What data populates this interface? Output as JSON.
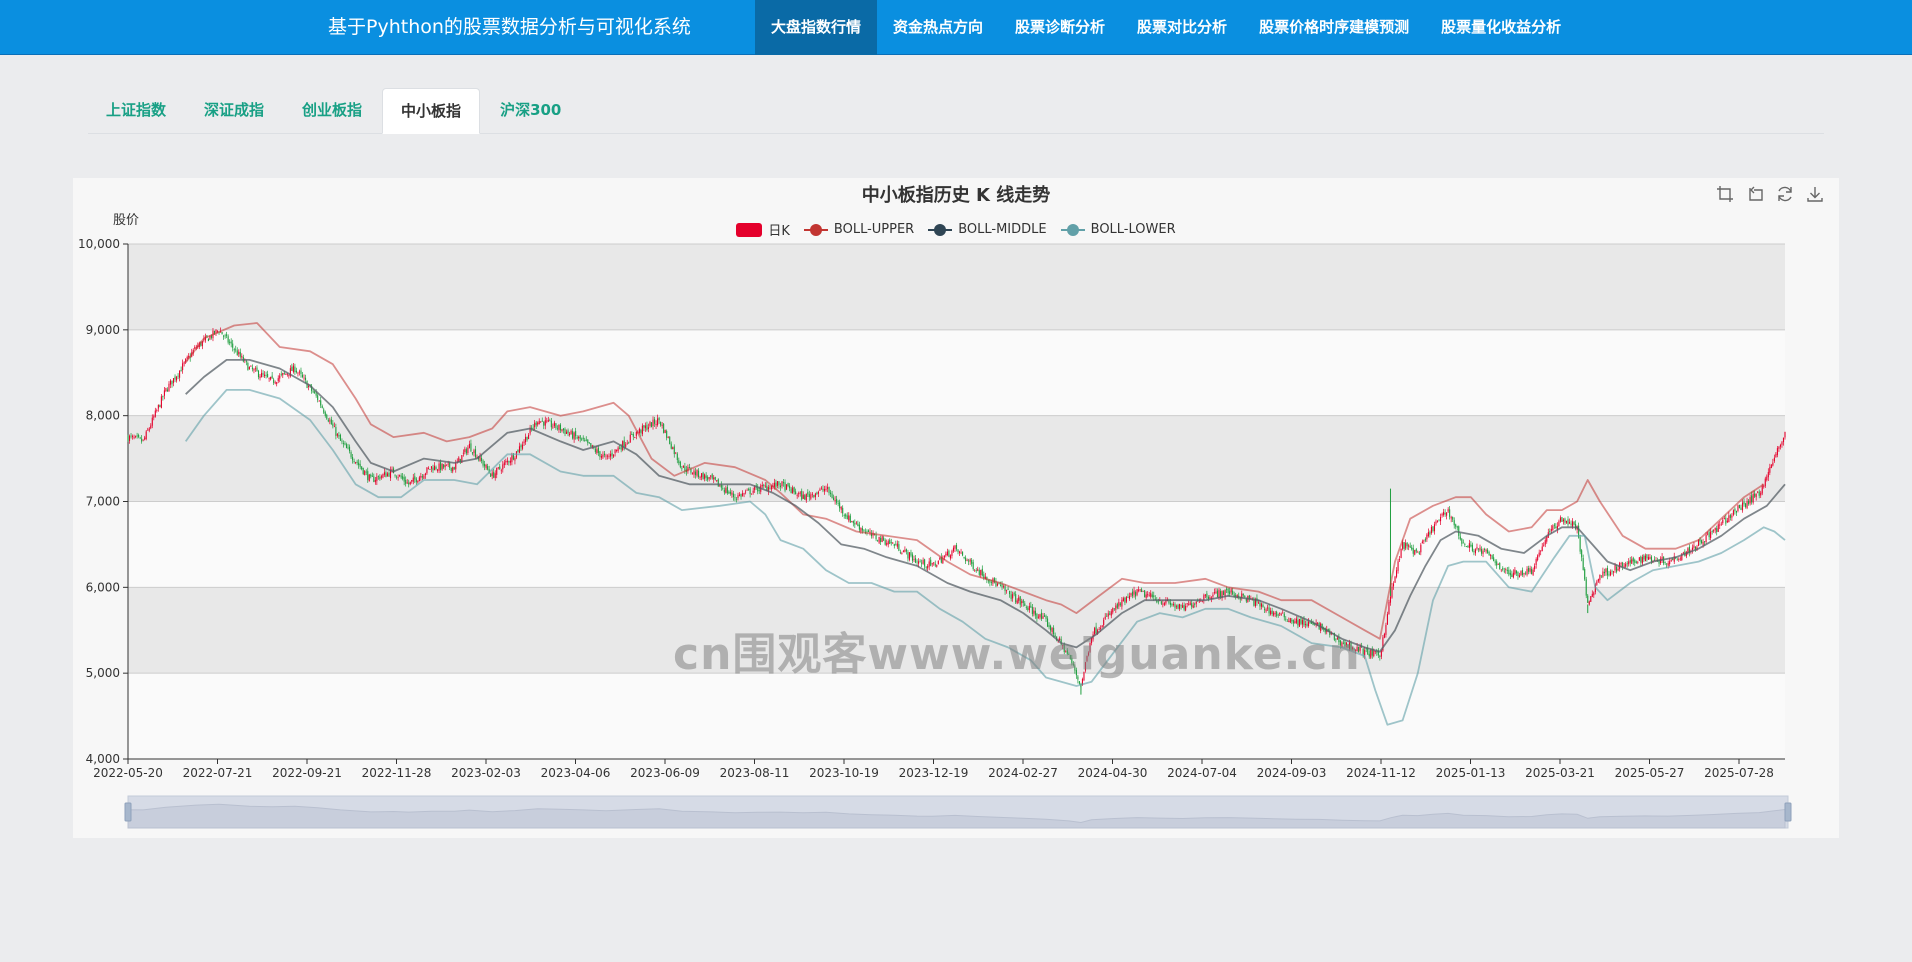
{
  "app": {
    "title": "基于Pyhthon的股票数据分析与可视化系统"
  },
  "nav": [
    {
      "label": "大盘指数行情",
      "active": true
    },
    {
      "label": "资金热点方向",
      "active": false
    },
    {
      "label": "股票诊断分析",
      "active": false
    },
    {
      "label": "股票对比分析",
      "active": false
    },
    {
      "label": "股票价格时序建模预测",
      "active": false
    },
    {
      "label": "股票量化收益分析",
      "active": false
    }
  ],
  "tabs": [
    {
      "label": "上证指数",
      "active": false
    },
    {
      "label": "深证成指",
      "active": false
    },
    {
      "label": "创业板指",
      "active": false
    },
    {
      "label": "中小板指",
      "active": true
    },
    {
      "label": "沪深300",
      "active": false
    }
  ],
  "watermark": "cn围观客www.weiguanke.cn",
  "colors": {
    "up": "#e4002b",
    "down": "#1e9e3e",
    "upper": "#c23531",
    "middle": "#2f4554",
    "lower": "#61a0a8"
  },
  "chart_data": {
    "type": "candlestick",
    "title": "中小板指历史 K 线走势",
    "ylabel": "股价",
    "ylim": [
      4000,
      10000
    ],
    "yticks": [
      "4,000",
      "5,000",
      "6,000",
      "7,000",
      "8,000",
      "9,000",
      "10,000"
    ],
    "xticks": [
      "2022-05-20",
      "2022-07-21",
      "2022-09-21",
      "2022-11-28",
      "2023-02-03",
      "2023-04-06",
      "2023-06-09",
      "2023-08-11",
      "2023-10-19",
      "2023-12-19",
      "2024-02-27",
      "2024-04-30",
      "2024-07-04",
      "2024-09-03",
      "2024-11-12",
      "2025-01-13",
      "2025-03-21",
      "2025-05-27",
      "2025-07-28"
    ],
    "legend": [
      "日K",
      "BOLL-UPPER",
      "BOLL-MIDDLE",
      "BOLL-LOWER"
    ],
    "grid": true,
    "series": [
      {
        "name": "日K",
        "close": [
          [
            0,
            7750
          ],
          [
            10,
            7700
          ],
          [
            25,
            8300
          ],
          [
            45,
            8800
          ],
          [
            60,
            9000
          ],
          [
            80,
            8550
          ],
          [
            95,
            8400
          ],
          [
            110,
            8550
          ],
          [
            125,
            8200
          ],
          [
            140,
            7700
          ],
          [
            160,
            7250
          ],
          [
            175,
            7350
          ],
          [
            185,
            7200
          ],
          [
            200,
            7400
          ],
          [
            215,
            7400
          ],
          [
            225,
            7650
          ],
          [
            240,
            7300
          ],
          [
            255,
            7550
          ],
          [
            270,
            7950
          ],
          [
            285,
            7850
          ],
          [
            300,
            7700
          ],
          [
            315,
            7500
          ],
          [
            335,
            7800
          ],
          [
            350,
            7950
          ],
          [
            365,
            7400
          ],
          [
            385,
            7250
          ],
          [
            400,
            7050
          ],
          [
            415,
            7150
          ],
          [
            430,
            7200
          ],
          [
            445,
            7050
          ],
          [
            460,
            7150
          ],
          [
            475,
            6800
          ],
          [
            490,
            6600
          ],
          [
            505,
            6500
          ],
          [
            520,
            6300
          ],
          [
            530,
            6250
          ],
          [
            545,
            6450
          ],
          [
            560,
            6200
          ],
          [
            575,
            6000
          ],
          [
            590,
            5800
          ],
          [
            605,
            5600
          ],
          [
            620,
            5200
          ],
          [
            628,
            4850
          ],
          [
            635,
            5450
          ],
          [
            650,
            5750
          ],
          [
            665,
            5950
          ],
          [
            680,
            5850
          ],
          [
            695,
            5750
          ],
          [
            710,
            5900
          ],
          [
            725,
            5950
          ],
          [
            740,
            5850
          ],
          [
            755,
            5700
          ],
          [
            770,
            5600
          ],
          [
            785,
            5550
          ],
          [
            800,
            5350
          ],
          [
            815,
            5250
          ],
          [
            825,
            5200
          ],
          [
            832,
            5900
          ],
          [
            840,
            6500
          ],
          [
            850,
            6400
          ],
          [
            860,
            6700
          ],
          [
            870,
            6900
          ],
          [
            880,
            6500
          ],
          [
            895,
            6400
          ],
          [
            910,
            6150
          ],
          [
            925,
            6200
          ],
          [
            935,
            6600
          ],
          [
            945,
            6800
          ],
          [
            955,
            6700
          ],
          [
            962,
            5800
          ],
          [
            970,
            6150
          ],
          [
            985,
            6250
          ],
          [
            1000,
            6350
          ],
          [
            1015,
            6300
          ],
          [
            1030,
            6450
          ],
          [
            1045,
            6650
          ],
          [
            1060,
            6900
          ],
          [
            1075,
            7100
          ],
          [
            1085,
            7500
          ],
          [
            1092,
            7800
          ]
        ]
      },
      {
        "name": "BOLL-UPPER",
        "values": [
          [
            38,
            8620
          ],
          [
            50,
            8900
          ],
          [
            70,
            9050
          ],
          [
            85,
            9080
          ],
          [
            100,
            8800
          ],
          [
            120,
            8750
          ],
          [
            135,
            8600
          ],
          [
            150,
            8200
          ],
          [
            160,
            7900
          ],
          [
            175,
            7750
          ],
          [
            195,
            7800
          ],
          [
            210,
            7700
          ],
          [
            225,
            7750
          ],
          [
            240,
            7850
          ],
          [
            250,
            8050
          ],
          [
            265,
            8100
          ],
          [
            285,
            8000
          ],
          [
            300,
            8050
          ],
          [
            320,
            8150
          ],
          [
            330,
            8000
          ],
          [
            345,
            7500
          ],
          [
            360,
            7300
          ],
          [
            380,
            7450
          ],
          [
            400,
            7400
          ],
          [
            420,
            7250
          ],
          [
            430,
            7100
          ],
          [
            445,
            6850
          ],
          [
            460,
            6800
          ],
          [
            480,
            6650
          ],
          [
            500,
            6600
          ],
          [
            520,
            6550
          ],
          [
            540,
            6300
          ],
          [
            555,
            6150
          ],
          [
            575,
            6050
          ],
          [
            590,
            5950
          ],
          [
            605,
            5850
          ],
          [
            615,
            5800
          ],
          [
            625,
            5700
          ],
          [
            640,
            5900
          ],
          [
            655,
            6100
          ],
          [
            670,
            6050
          ],
          [
            690,
            6050
          ],
          [
            710,
            6100
          ],
          [
            725,
            6000
          ],
          [
            745,
            5950
          ],
          [
            760,
            5850
          ],
          [
            780,
            5850
          ],
          [
            800,
            5650
          ],
          [
            815,
            5500
          ],
          [
            825,
            5400
          ],
          [
            835,
            6300
          ],
          [
            845,
            6800
          ],
          [
            860,
            6950
          ],
          [
            875,
            7050
          ],
          [
            885,
            7050
          ],
          [
            895,
            6850
          ],
          [
            910,
            6650
          ],
          [
            925,
            6700
          ],
          [
            935,
            6900
          ],
          [
            945,
            6900
          ],
          [
            955,
            7000
          ],
          [
            962,
            7250
          ],
          [
            970,
            7000
          ],
          [
            985,
            6600
          ],
          [
            1000,
            6450
          ],
          [
            1020,
            6450
          ],
          [
            1035,
            6550
          ],
          [
            1050,
            6800
          ],
          [
            1065,
            7050
          ],
          [
            1078,
            7200
          ]
        ]
      },
      {
        "name": "BOLL-MIDDLE",
        "values": [
          [
            38,
            8250
          ],
          [
            50,
            8450
          ],
          [
            65,
            8650
          ],
          [
            80,
            8650
          ],
          [
            100,
            8550
          ],
          [
            120,
            8350
          ],
          [
            135,
            8100
          ],
          [
            150,
            7700
          ],
          [
            160,
            7450
          ],
          [
            175,
            7350
          ],
          [
            195,
            7500
          ],
          [
            215,
            7450
          ],
          [
            230,
            7500
          ],
          [
            250,
            7800
          ],
          [
            265,
            7850
          ],
          [
            285,
            7700
          ],
          [
            300,
            7600
          ],
          [
            320,
            7700
          ],
          [
            335,
            7550
          ],
          [
            350,
            7300
          ],
          [
            370,
            7200
          ],
          [
            390,
            7200
          ],
          [
            410,
            7200
          ],
          [
            425,
            7100
          ],
          [
            440,
            6950
          ],
          [
            455,
            6750
          ],
          [
            470,
            6500
          ],
          [
            485,
            6450
          ],
          [
            500,
            6350
          ],
          [
            520,
            6250
          ],
          [
            540,
            6050
          ],
          [
            555,
            5950
          ],
          [
            575,
            5850
          ],
          [
            590,
            5700
          ],
          [
            605,
            5500
          ],
          [
            615,
            5350
          ],
          [
            625,
            5300
          ],
          [
            638,
            5450
          ],
          [
            655,
            5700
          ],
          [
            670,
            5850
          ],
          [
            690,
            5850
          ],
          [
            710,
            5850
          ],
          [
            725,
            5900
          ],
          [
            745,
            5850
          ],
          [
            760,
            5750
          ],
          [
            780,
            5600
          ],
          [
            800,
            5400
          ],
          [
            815,
            5300
          ],
          [
            825,
            5250
          ],
          [
            835,
            5500
          ],
          [
            845,
            5900
          ],
          [
            855,
            6250
          ],
          [
            865,
            6550
          ],
          [
            875,
            6650
          ],
          [
            890,
            6600
          ],
          [
            905,
            6450
          ],
          [
            920,
            6400
          ],
          [
            935,
            6600
          ],
          [
            945,
            6700
          ],
          [
            955,
            6700
          ],
          [
            965,
            6500
          ],
          [
            975,
            6300
          ],
          [
            990,
            6200
          ],
          [
            1005,
            6300
          ],
          [
            1020,
            6350
          ],
          [
            1035,
            6450
          ],
          [
            1050,
            6600
          ],
          [
            1065,
            6800
          ],
          [
            1080,
            6950
          ],
          [
            1092,
            7200
          ]
        ]
      },
      {
        "name": "BOLL-LOWER",
        "values": [
          [
            38,
            7700
          ],
          [
            50,
            8000
          ],
          [
            65,
            8300
          ],
          [
            80,
            8300
          ],
          [
            100,
            8200
          ],
          [
            120,
            7950
          ],
          [
            135,
            7600
          ],
          [
            150,
            7200
          ],
          [
            165,
            7050
          ],
          [
            180,
            7050
          ],
          [
            195,
            7250
          ],
          [
            215,
            7250
          ],
          [
            230,
            7200
          ],
          [
            250,
            7550
          ],
          [
            265,
            7550
          ],
          [
            285,
            7350
          ],
          [
            300,
            7300
          ],
          [
            320,
            7300
          ],
          [
            335,
            7100
          ],
          [
            350,
            7050
          ],
          [
            365,
            6900
          ],
          [
            390,
            6950
          ],
          [
            410,
            7000
          ],
          [
            420,
            6850
          ],
          [
            430,
            6550
          ],
          [
            445,
            6450
          ],
          [
            460,
            6200
          ],
          [
            475,
            6050
          ],
          [
            490,
            6050
          ],
          [
            505,
            5950
          ],
          [
            520,
            5950
          ],
          [
            535,
            5750
          ],
          [
            550,
            5600
          ],
          [
            565,
            5400
          ],
          [
            580,
            5300
          ],
          [
            595,
            5150
          ],
          [
            605,
            4950
          ],
          [
            615,
            4900
          ],
          [
            625,
            4850
          ],
          [
            635,
            4900
          ],
          [
            650,
            5250
          ],
          [
            665,
            5600
          ],
          [
            680,
            5700
          ],
          [
            695,
            5650
          ],
          [
            710,
            5750
          ],
          [
            725,
            5750
          ],
          [
            740,
            5650
          ],
          [
            760,
            5550
          ],
          [
            780,
            5350
          ],
          [
            800,
            5300
          ],
          [
            815,
            5200
          ],
          [
            822,
            4800
          ],
          [
            830,
            4400
          ],
          [
            840,
            4450
          ],
          [
            850,
            5000
          ],
          [
            860,
            5850
          ],
          [
            870,
            6250
          ],
          [
            880,
            6300
          ],
          [
            895,
            6300
          ],
          [
            910,
            6000
          ],
          [
            925,
            5950
          ],
          [
            940,
            6350
          ],
          [
            950,
            6600
          ],
          [
            960,
            6600
          ],
          [
            967,
            6000
          ],
          [
            975,
            5850
          ],
          [
            990,
            6050
          ],
          [
            1005,
            6200
          ],
          [
            1020,
            6250
          ],
          [
            1035,
            6300
          ],
          [
            1050,
            6400
          ],
          [
            1065,
            6550
          ],
          [
            1078,
            6700
          ],
          [
            1085,
            6650
          ],
          [
            1092,
            6550
          ]
        ]
      }
    ]
  }
}
